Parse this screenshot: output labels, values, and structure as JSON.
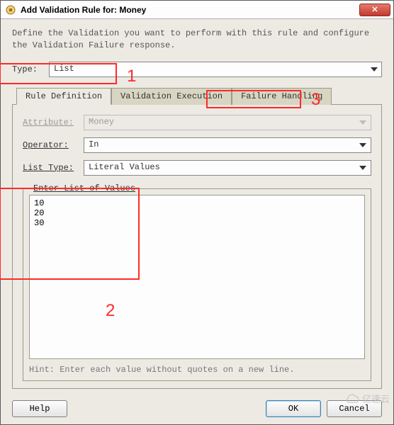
{
  "window": {
    "title": "Add Validation Rule for: Money",
    "description": "Define the Validation you want to perform with this rule and configure the Validation Failure response."
  },
  "type": {
    "label": "Type:",
    "value": "List"
  },
  "tabs": {
    "rule_def": "Rule Definition",
    "val_exec": "Validation Execution",
    "fail_hand": "Failure Handling",
    "selected": 0
  },
  "form": {
    "attribute_label": "Attribute:",
    "attribute_value": "Money",
    "operator_label": "Operator:",
    "operator_value": "In",
    "list_type_label": "List Type:",
    "list_type_value": "Literal Values"
  },
  "list_values": {
    "legend": "Enter List of Values",
    "content": "10\n20\n30",
    "hint": "Hint: Enter each value without quotes on a new line."
  },
  "buttons": {
    "help": "Help",
    "ok": "OK",
    "cancel": "Cancel"
  },
  "annotations": {
    "n1": "1",
    "n2": "2",
    "n3": "3"
  },
  "watermark": "亿速云",
  "colors": {
    "annotation": "#ff2a2a",
    "panel_bg": "#eceae3"
  }
}
